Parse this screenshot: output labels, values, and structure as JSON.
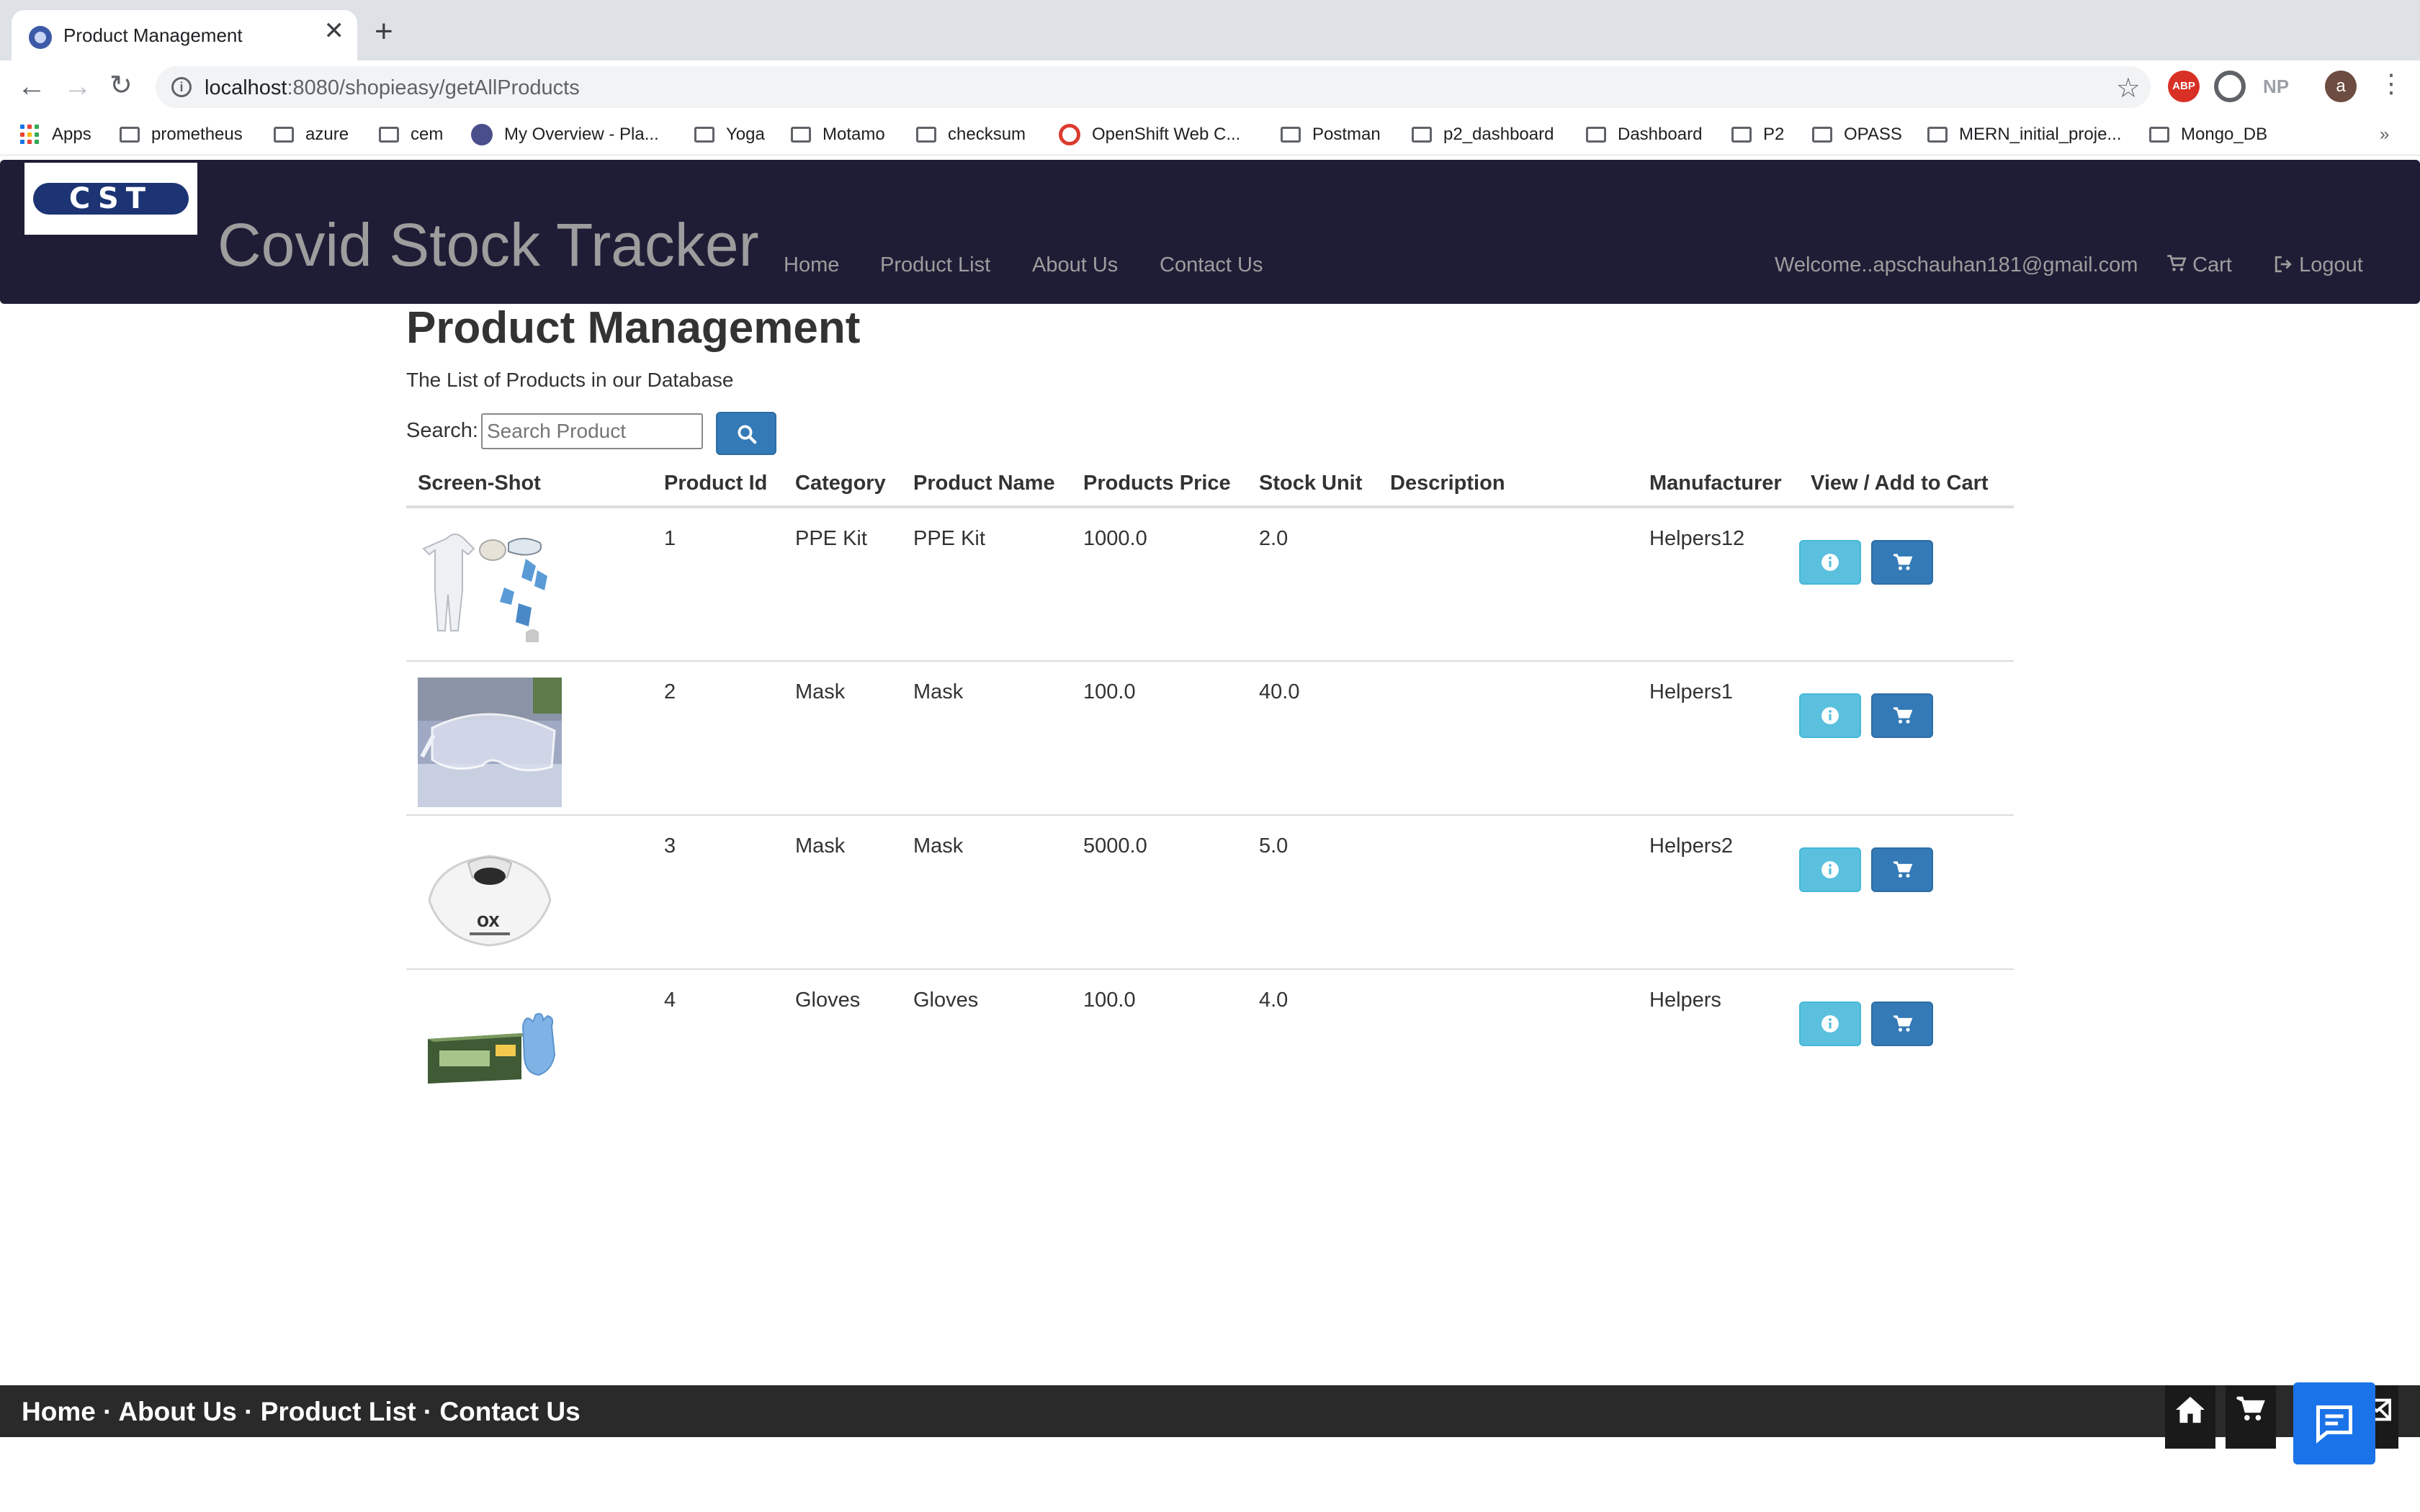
{
  "browser": {
    "tab_title": "Product Management",
    "tab_close": "✕",
    "new_tab": "+",
    "url_host": "localhost",
    "url_path": ":8080/shopieasy/getAllProducts",
    "extensions": [
      "ABP",
      "NP",
      "a"
    ],
    "bookmarks": [
      "Apps",
      "prometheus",
      "azure",
      "cem",
      "My Overview - Pla...",
      "Yoga",
      "Motamo",
      "checksum",
      "OpenShift Web C...",
      "Postman",
      "p2_dashboard",
      "Dashboard",
      "P2",
      "OPASS",
      "MERN_initial_proje...",
      "Mongo_DB"
    ],
    "overflow": "»"
  },
  "navbar": {
    "logo_text": "CST",
    "brand": "Covid Stock Tracker",
    "links": [
      "Home",
      "Product List",
      "About Us",
      "Contact Us"
    ],
    "welcome": "Welcome..apschauhan181@gmail.com",
    "cart": "Cart",
    "logout": "Logout"
  },
  "main": {
    "title": "Product Management",
    "subtitle": "The List of Products in our Database",
    "search_label": "Search:",
    "search_placeholder": "Search Product"
  },
  "table": {
    "headers": [
      "Screen-Shot",
      "Product Id",
      "Category",
      "Product Name",
      "Products Price",
      "Stock Unit",
      "Description",
      "Manufacturer",
      "View / Add to Cart"
    ],
    "rows": [
      {
        "id": "1",
        "category": "PPE Kit",
        "name": "PPE Kit",
        "price": "1000.0",
        "stock": "2.0",
        "description": "",
        "manufacturer": "Helpers12",
        "image": "ppe-kit-image"
      },
      {
        "id": "2",
        "category": "Mask",
        "name": "Mask",
        "price": "100.0",
        "stock": "40.0",
        "description": "",
        "manufacturer": "Helpers1",
        "image": "goggles-image"
      },
      {
        "id": "3",
        "category": "Mask",
        "name": "Mask",
        "price": "5000.0",
        "stock": "5.0",
        "description": "",
        "manufacturer": "Helpers2",
        "image": "respirator-mask-image"
      },
      {
        "id": "4",
        "category": "Gloves",
        "name": "Gloves",
        "price": "100.0",
        "stock": "4.0",
        "description": "",
        "manufacturer": "Helpers",
        "image": "gloves-box-image"
      }
    ]
  },
  "footer": {
    "links": [
      "Home",
      "About Us",
      "Product List",
      "Contact Us"
    ],
    "separator": "·"
  },
  "icons": {
    "search": "search-icon",
    "cart": "shopping-cart-icon",
    "info": "info-icon",
    "home": "home-icon",
    "chat": "chat-icon"
  },
  "colors": {
    "navbar_bg": "#1f1d36",
    "primary": "#337ab7",
    "info": "#5bc0de",
    "footer_bg": "#2a2a2a",
    "chat": "#1a73e8"
  }
}
